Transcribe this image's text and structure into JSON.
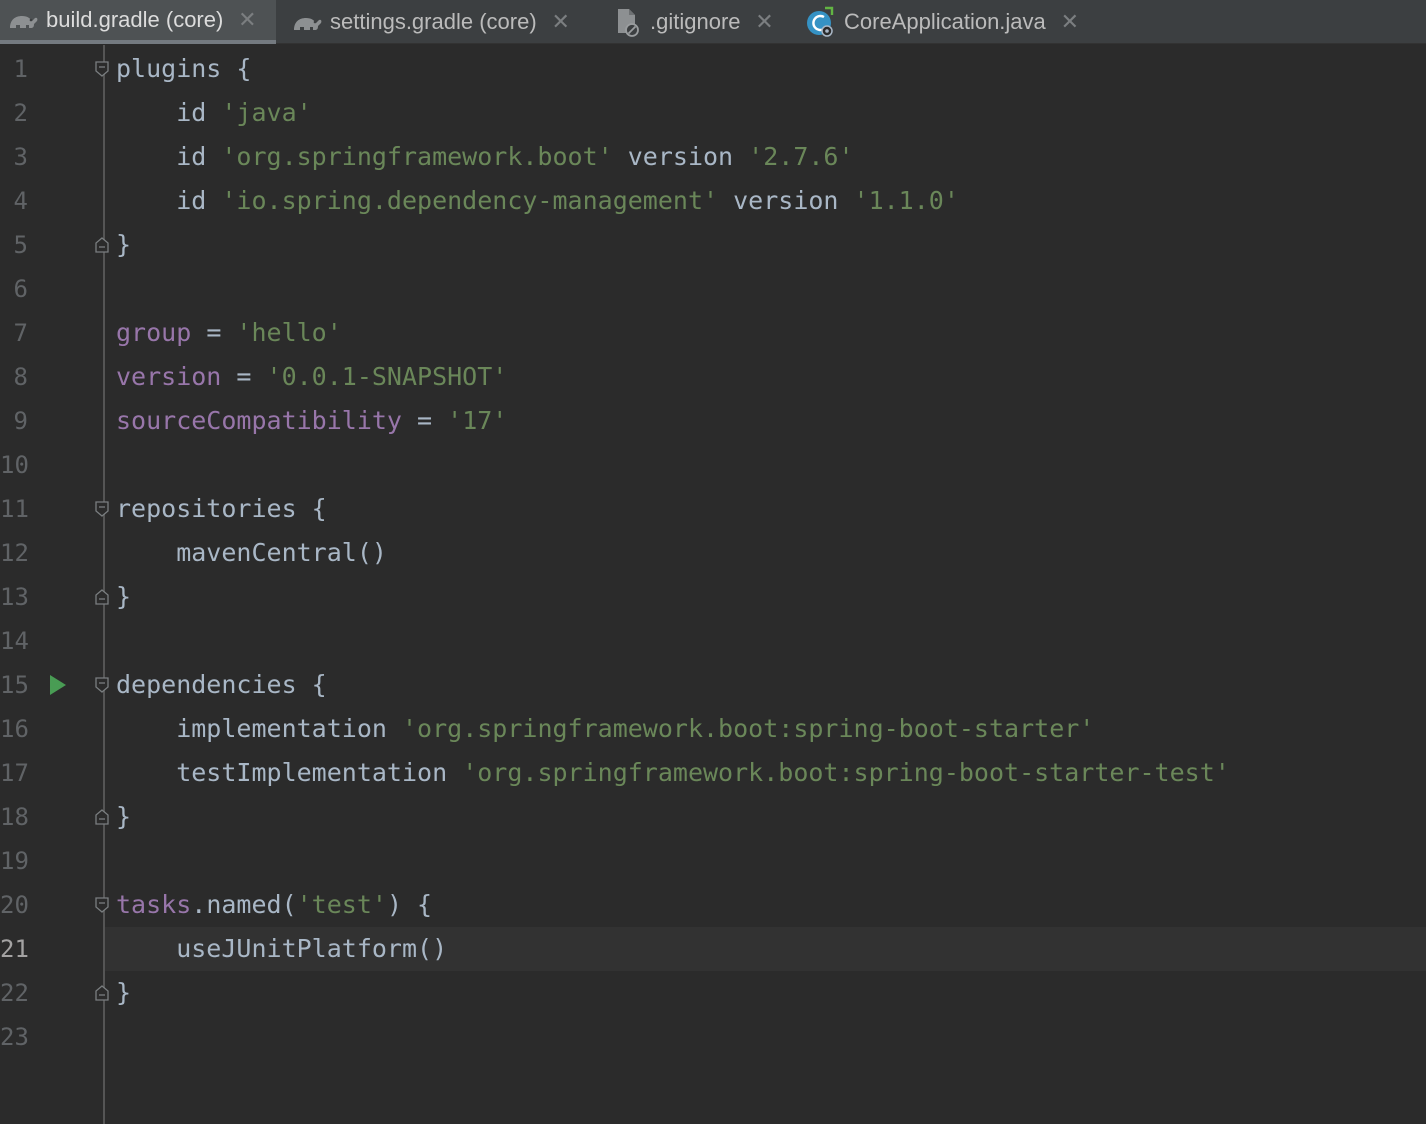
{
  "tabs": [
    {
      "label": "build.gradle (core)",
      "icon": "gradle-icon",
      "active": true
    },
    {
      "label": "settings.gradle (core)",
      "icon": "gradle-icon",
      "active": false
    },
    {
      "label": ".gitignore",
      "icon": "ignore-file-icon",
      "active": false
    },
    {
      "label": "CoreApplication.java",
      "icon": "spring-boot-class-icon",
      "active": false
    }
  ],
  "tab_close_glyph": "✕",
  "colors": {
    "background": "#2b2b2b",
    "string": "#6a8759",
    "property": "#9876aa",
    "default_text": "#a9b7c6",
    "run_icon": "#499c54"
  },
  "editor": {
    "current_line": 21,
    "lines": [
      {
        "n": "1",
        "tokens": [
          {
            "t": "plugins {",
            "c": "def"
          }
        ],
        "fold": "open"
      },
      {
        "n": "2",
        "tokens": [
          {
            "t": "    id ",
            "c": "def"
          },
          {
            "t": "'java'",
            "c": "str"
          }
        ]
      },
      {
        "n": "3",
        "tokens": [
          {
            "t": "    id ",
            "c": "def"
          },
          {
            "t": "'org.springframework.boot'",
            "c": "str"
          },
          {
            "t": " version ",
            "c": "def"
          },
          {
            "t": "'2.7.6'",
            "c": "str"
          }
        ]
      },
      {
        "n": "4",
        "tokens": [
          {
            "t": "    id ",
            "c": "def"
          },
          {
            "t": "'io.spring.dependency-management'",
            "c": "str"
          },
          {
            "t": " version ",
            "c": "def"
          },
          {
            "t": "'1.1.0'",
            "c": "str"
          }
        ]
      },
      {
        "n": "5",
        "tokens": [
          {
            "t": "}",
            "c": "def"
          }
        ],
        "fold": "close"
      },
      {
        "n": "6",
        "tokens": []
      },
      {
        "n": "7",
        "tokens": [
          {
            "t": "group",
            "c": "prop"
          },
          {
            "t": " = ",
            "c": "def"
          },
          {
            "t": "'hello'",
            "c": "str"
          }
        ]
      },
      {
        "n": "8",
        "tokens": [
          {
            "t": "version",
            "c": "prop"
          },
          {
            "t": " = ",
            "c": "def"
          },
          {
            "t": "'0.0.1-SNAPSHOT'",
            "c": "str"
          }
        ]
      },
      {
        "n": "9",
        "tokens": [
          {
            "t": "sourceCompatibility",
            "c": "prop"
          },
          {
            "t": " = ",
            "c": "def"
          },
          {
            "t": "'17'",
            "c": "str"
          }
        ]
      },
      {
        "n": "10",
        "tokens": []
      },
      {
        "n": "11",
        "tokens": [
          {
            "t": "repositories {",
            "c": "def"
          }
        ],
        "fold": "open"
      },
      {
        "n": "12",
        "tokens": [
          {
            "t": "    mavenCentral()",
            "c": "def"
          }
        ]
      },
      {
        "n": "13",
        "tokens": [
          {
            "t": "}",
            "c": "def"
          }
        ],
        "fold": "close"
      },
      {
        "n": "14",
        "tokens": []
      },
      {
        "n": "15",
        "tokens": [
          {
            "t": "dependencies {",
            "c": "def"
          }
        ],
        "fold": "open",
        "run": true
      },
      {
        "n": "16",
        "tokens": [
          {
            "t": "    implementation ",
            "c": "def"
          },
          {
            "t": "'org.springframework.boot:spring-boot-starter'",
            "c": "str"
          }
        ]
      },
      {
        "n": "17",
        "tokens": [
          {
            "t": "    testImplementation ",
            "c": "def"
          },
          {
            "t": "'org.springframework.boot:spring-boot-starter-test'",
            "c": "str"
          }
        ]
      },
      {
        "n": "18",
        "tokens": [
          {
            "t": "}",
            "c": "def"
          }
        ],
        "fold": "close"
      },
      {
        "n": "19",
        "tokens": []
      },
      {
        "n": "20",
        "tokens": [
          {
            "t": "tasks",
            "c": "prop"
          },
          {
            "t": ".named(",
            "c": "def"
          },
          {
            "t": "'test'",
            "c": "str"
          },
          {
            "t": ") {",
            "c": "def"
          }
        ],
        "fold": "open"
      },
      {
        "n": "21",
        "tokens": [
          {
            "t": "    useJUnitPlatform()",
            "c": "def"
          }
        ]
      },
      {
        "n": "22",
        "tokens": [
          {
            "t": "}",
            "c": "def"
          }
        ],
        "fold": "close"
      },
      {
        "n": "23",
        "tokens": []
      }
    ]
  }
}
